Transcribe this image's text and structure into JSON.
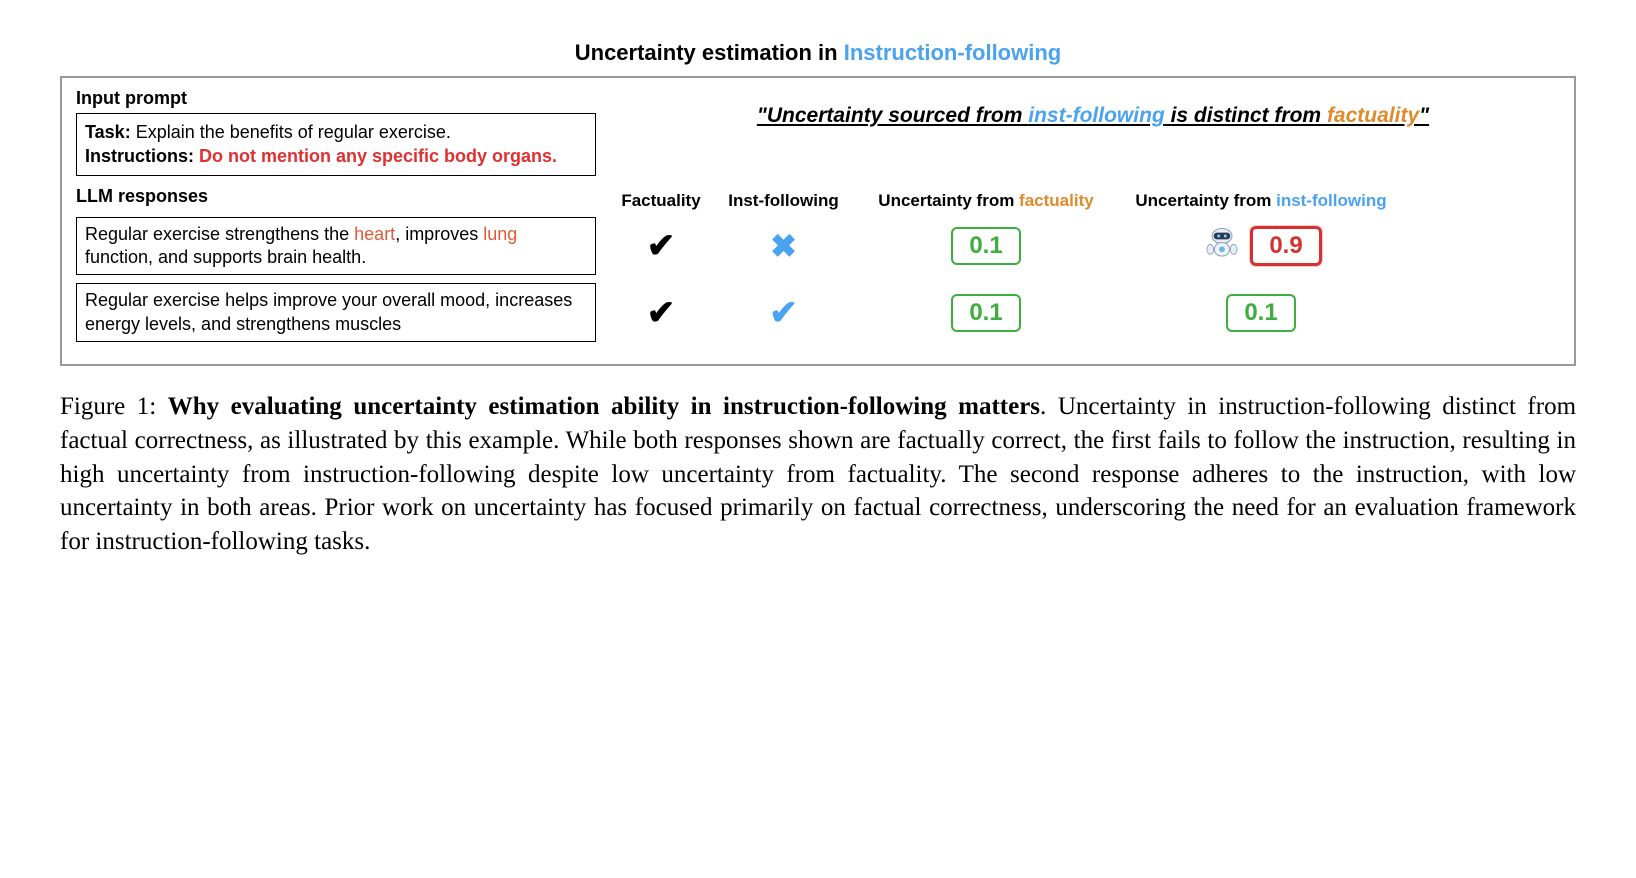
{
  "title": {
    "prefix": "Uncertainty estimation in ",
    "highlight": "Instruction-following"
  },
  "input": {
    "label": "Input prompt",
    "task_label": "Task:",
    "task_text": " Explain the benefits of regular exercise.",
    "instructions_label": "Instructions:",
    "instructions_text": " Do not mention any specific body organs."
  },
  "quote": {
    "open": "\"",
    "part1": "Uncertainty sourced from ",
    "inst": "inst-following",
    "part2": " is distinct from ",
    "fact": "factuality",
    "close": "\""
  },
  "responses": {
    "label": "LLM responses",
    "cols": {
      "factuality": "Factuality",
      "inst": "Inst-following",
      "ufact_pre": "Uncertainty from ",
      "ufact_hl": "factuality",
      "uinst_pre": "Uncertainty from ",
      "uinst_hl": "inst-following"
    },
    "rows": [
      {
        "text_parts": [
          "Regular exercise strengthens the ",
          "heart",
          ", improves ",
          "lung",
          " function, and supports brain health."
        ],
        "factuality": "check",
        "inst": "cross",
        "ufact": "0.1",
        "uinst": "0.9",
        "uinst_style": "red",
        "show_robot": true
      },
      {
        "text_parts": [
          "Regular exercise helps improve your overall mood, increases energy levels, and strengthens muscles"
        ],
        "factuality": "check",
        "inst": "check",
        "ufact": "0.1",
        "uinst": "0.1",
        "uinst_style": "green",
        "show_robot": false
      }
    ]
  },
  "caption": {
    "fig": "Figure 1: ",
    "bold": "Why evaluating uncertainty estimation ability in instruction-following matters",
    "rest": ". Uncertainty in instruction-following distinct from factual correctness, as illustrated by this example. While both responses shown are factually correct, the first fails to follow the instruction, resulting in high uncertainty from instruction-following despite low uncertainty from factuality. The second response adheres to the instruction, with low uncertainty in both areas. Prior work on uncertainty has focused primarily on factual correctness, underscoring the need for an evaluation framework for instruction-following tasks."
  },
  "icons": {
    "check": "✔",
    "cross": "✖"
  }
}
